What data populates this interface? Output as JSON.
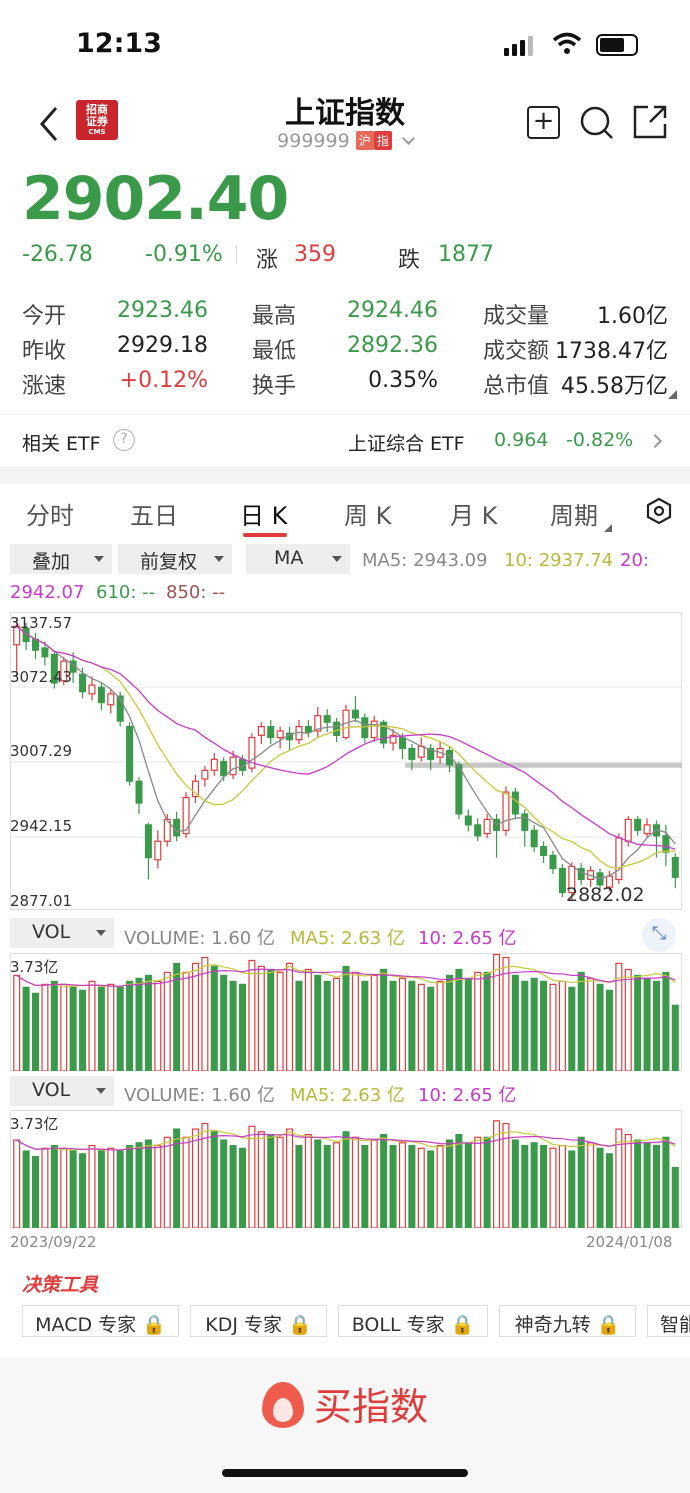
{
  "status": {
    "time": "12:13"
  },
  "header": {
    "title": "上证指数",
    "code": "999999",
    "tag_market": "沪",
    "tag_index": "指",
    "logo_text": "招商证券",
    "logo_sub": "CMS"
  },
  "quote": {
    "price": "2902.40",
    "change": "-26.78",
    "change_pct": "-0.91%",
    "up_label": "涨",
    "up_count": "359",
    "down_label": "跌",
    "down_count": "1877"
  },
  "stats": [
    {
      "label": "今开",
      "value": "2923.46",
      "color": "green"
    },
    {
      "label": "最高",
      "value": "2924.46",
      "color": "green"
    },
    {
      "label": "成交量",
      "value": "1.60亿",
      "color": "dark"
    },
    {
      "label": "昨收",
      "value": "2929.18",
      "color": "dark"
    },
    {
      "label": "最低",
      "value": "2892.36",
      "color": "green"
    },
    {
      "label": "成交额",
      "value": "1738.47亿",
      "color": "dark"
    },
    {
      "label": "涨速",
      "value": "+0.12%",
      "color": "red"
    },
    {
      "label": "换手",
      "value": "0.35%",
      "color": "dark"
    },
    {
      "label": "总市值",
      "value": "45.58万亿",
      "color": "dark"
    }
  ],
  "etf": {
    "label": "相关 ETF",
    "help": "?",
    "name": "上证综合 ETF",
    "price": "0.964",
    "change": "-0.82%"
  },
  "tabs": [
    "分时",
    "五日",
    "日 K",
    "周 K",
    "月 K",
    "周期"
  ],
  "active_tab": "日 K",
  "selectors": {
    "overlay": "叠加",
    "adjust": "前复权",
    "indicator": "MA"
  },
  "ma_line": {
    "ma5": "MA5: 2943.09",
    "ma10": "10: 2937.74",
    "ma20_a": "20:",
    "ma20_b": "2942.07",
    "ma610": "610: --",
    "ma850": "850: --"
  },
  "kchart": {
    "y_labels": [
      "3137.57",
      "3072.43",
      "3007.29",
      "2942.15",
      "2877.01"
    ],
    "low_mark": "2882.02",
    "colors": {
      "up": "#e03c3c",
      "down": "#3a9a4a",
      "ma5": "#888888",
      "ma10": "#c8c83a",
      "ma20": "#c83ac8"
    }
  },
  "vol1": {
    "selector": "VOL",
    "volume": "VOLUME: 1.60 亿",
    "ma5": "MA5: 2.63 亿",
    "ma10": "10: 2.65 亿",
    "max": "3.73亿"
  },
  "vol2": {
    "selector": "VOL",
    "volume": "VOLUME: 1.60 亿",
    "ma5": "MA5: 2.63 亿",
    "ma10": "10: 2.65 亿",
    "max": "3.73亿"
  },
  "dates": {
    "start": "2023/09/22",
    "end": "2024/01/08"
  },
  "tools": {
    "title": "决策工具",
    "items": [
      "MACD 专家",
      "KDJ 专家",
      "BOLL 专家",
      "神奇九转",
      "智能"
    ]
  },
  "buy_label": "买指数",
  "candles": [
    {
      "o": 3115,
      "c": 3132,
      "h": 3140,
      "l": 3085
    },
    {
      "o": 3130,
      "c": 3118,
      "h": 3135,
      "l": 3110
    },
    {
      "o": 3120,
      "c": 3110,
      "h": 3126,
      "l": 3102
    },
    {
      "o": 3112,
      "c": 3104,
      "h": 3118,
      "l": 3096
    },
    {
      "o": 3106,
      "c": 3080,
      "h": 3110,
      "l": 3075
    },
    {
      "o": 3082,
      "c": 3100,
      "h": 3104,
      "l": 3078
    },
    {
      "o": 3100,
      "c": 3090,
      "h": 3108,
      "l": 3080
    },
    {
      "o": 3088,
      "c": 3072,
      "h": 3094,
      "l": 3066
    },
    {
      "o": 3070,
      "c": 3078,
      "h": 3086,
      "l": 3064
    },
    {
      "o": 3076,
      "c": 3062,
      "h": 3080,
      "l": 3055
    },
    {
      "o": 3060,
      "c": 3070,
      "h": 3074,
      "l": 3052
    },
    {
      "o": 3068,
      "c": 3045,
      "h": 3072,
      "l": 3040
    },
    {
      "o": 3040,
      "c": 2990,
      "h": 3044,
      "l": 2986
    },
    {
      "o": 2990,
      "c": 2970,
      "h": 2994,
      "l": 2960
    },
    {
      "o": 2950,
      "c": 2920,
      "h": 2952,
      "l": 2900
    },
    {
      "o": 2918,
      "c": 2935,
      "h": 2945,
      "l": 2910
    },
    {
      "o": 2935,
      "c": 2955,
      "h": 2960,
      "l": 2930
    },
    {
      "o": 2955,
      "c": 2940,
      "h": 2962,
      "l": 2935
    },
    {
      "o": 2942,
      "c": 2975,
      "h": 2980,
      "l": 2938
    },
    {
      "o": 2976,
      "c": 2990,
      "h": 2996,
      "l": 2970
    },
    {
      "o": 2992,
      "c": 3000,
      "h": 3004,
      "l": 2985
    },
    {
      "o": 3000,
      "c": 3010,
      "h": 3016,
      "l": 2995
    },
    {
      "o": 3008,
      "c": 2995,
      "h": 3012,
      "l": 2990
    },
    {
      "o": 2996,
      "c": 3012,
      "h": 3018,
      "l": 2992
    },
    {
      "o": 3010,
      "c": 3000,
      "h": 3014,
      "l": 2995
    },
    {
      "o": 3002,
      "c": 3030,
      "h": 3034,
      "l": 2998
    },
    {
      "o": 3032,
      "c": 3040,
      "h": 3044,
      "l": 3024
    },
    {
      "o": 3040,
      "c": 3030,
      "h": 3046,
      "l": 3024
    },
    {
      "o": 3030,
      "c": 3036,
      "h": 3040,
      "l": 3020
    },
    {
      "o": 3034,
      "c": 3028,
      "h": 3040,
      "l": 3018
    },
    {
      "o": 3028,
      "c": 3040,
      "h": 3046,
      "l": 3024
    },
    {
      "o": 3040,
      "c": 3035,
      "h": 3046,
      "l": 3030
    },
    {
      "o": 3036,
      "c": 3050,
      "h": 3058,
      "l": 3030
    },
    {
      "o": 3050,
      "c": 3044,
      "h": 3056,
      "l": 3035
    },
    {
      "o": 3044,
      "c": 3032,
      "h": 3048,
      "l": 3026
    },
    {
      "o": 3030,
      "c": 3055,
      "h": 3060,
      "l": 3028
    },
    {
      "o": 3055,
      "c": 3048,
      "h": 3068,
      "l": 3044
    },
    {
      "o": 3048,
      "c": 3030,
      "h": 3052,
      "l": 3025
    },
    {
      "o": 3030,
      "c": 3045,
      "h": 3050,
      "l": 3026
    },
    {
      "o": 3044,
      "c": 3025,
      "h": 3046,
      "l": 3020
    },
    {
      "o": 3025,
      "c": 3032,
      "h": 3038,
      "l": 3018
    },
    {
      "o": 3030,
      "c": 3020,
      "h": 3034,
      "l": 3010
    },
    {
      "o": 3020,
      "c": 3010,
      "h": 3024,
      "l": 3000
    },
    {
      "o": 3012,
      "c": 3022,
      "h": 3030,
      "l": 3008
    },
    {
      "o": 3020,
      "c": 3010,
      "h": 3024,
      "l": 3000
    },
    {
      "o": 3012,
      "c": 3020,
      "h": 3026,
      "l": 3006
    },
    {
      "o": 3018,
      "c": 3005,
      "h": 3022,
      "l": 2998
    },
    {
      "o": 3005,
      "c": 2960,
      "h": 3008,
      "l": 2955
    },
    {
      "o": 2958,
      "c": 2950,
      "h": 2964,
      "l": 2944
    },
    {
      "o": 2950,
      "c": 2940,
      "h": 2956,
      "l": 2935
    },
    {
      "o": 2942,
      "c": 2955,
      "h": 2960,
      "l": 2938
    },
    {
      "o": 2955,
      "c": 2945,
      "h": 2960,
      "l": 2920
    },
    {
      "o": 2945,
      "c": 2980,
      "h": 2985,
      "l": 2940
    },
    {
      "o": 2980,
      "c": 2960,
      "h": 2984,
      "l": 2955
    },
    {
      "o": 2960,
      "c": 2945,
      "h": 2964,
      "l": 2930
    },
    {
      "o": 2945,
      "c": 2930,
      "h": 2950,
      "l": 2925
    },
    {
      "o": 2930,
      "c": 2922,
      "h": 2935,
      "l": 2915
    },
    {
      "o": 2922,
      "c": 2910,
      "h": 2926,
      "l": 2905
    },
    {
      "o": 2910,
      "c": 2888,
      "h": 2914,
      "l": 2884
    },
    {
      "o": 2888,
      "c": 2912,
      "h": 2916,
      "l": 2880
    },
    {
      "o": 2910,
      "c": 2900,
      "h": 2915,
      "l": 2895
    },
    {
      "o": 2900,
      "c": 2908,
      "h": 2912,
      "l": 2893
    },
    {
      "o": 2906,
      "c": 2895,
      "h": 2910,
      "l": 2890
    },
    {
      "o": 2893,
      "c": 2903,
      "h": 2908,
      "l": 2889
    },
    {
      "o": 2900,
      "c": 2938,
      "h": 2942,
      "l": 2896
    },
    {
      "o": 2935,
      "c": 2955,
      "h": 2958,
      "l": 2930
    },
    {
      "o": 2955,
      "c": 2945,
      "h": 2958,
      "l": 2940
    },
    {
      "o": 2942,
      "c": 2950,
      "h": 2956,
      "l": 2938
    },
    {
      "o": 2950,
      "c": 2940,
      "h": 2954,
      "l": 2920
    },
    {
      "o": 2940,
      "c": 2925,
      "h": 2950,
      "l": 2912
    },
    {
      "o": 2920,
      "c": 2902,
      "h": 2924,
      "l": 2892
    }
  ],
  "volumes": [
    {
      "v": 3.2,
      "up": true
    },
    {
      "v": 2.8,
      "up": false
    },
    {
      "v": 2.6,
      "up": false
    },
    {
      "v": 2.9,
      "up": true
    },
    {
      "v": 3.0,
      "up": false
    },
    {
      "v": 2.9,
      "up": true
    },
    {
      "v": 2.8,
      "up": false
    },
    {
      "v": 2.7,
      "up": false
    },
    {
      "v": 3.0,
      "up": true
    },
    {
      "v": 2.8,
      "up": false
    },
    {
      "v": 2.9,
      "up": true
    },
    {
      "v": 2.8,
      "up": false
    },
    {
      "v": 3.0,
      "up": false
    },
    {
      "v": 3.1,
      "up": false
    },
    {
      "v": 3.2,
      "up": false
    },
    {
      "v": 3.0,
      "up": true
    },
    {
      "v": 3.3,
      "up": true
    },
    {
      "v": 3.6,
      "up": false
    },
    {
      "v": 3.3,
      "up": true
    },
    {
      "v": 3.6,
      "up": true
    },
    {
      "v": 3.8,
      "up": true
    },
    {
      "v": 3.5,
      "up": false
    },
    {
      "v": 3.2,
      "up": false
    },
    {
      "v": 3.0,
      "up": false
    },
    {
      "v": 2.9,
      "up": false
    },
    {
      "v": 3.7,
      "up": true
    },
    {
      "v": 3.5,
      "up": true
    },
    {
      "v": 3.4,
      "up": false
    },
    {
      "v": 3.3,
      "up": true
    },
    {
      "v": 3.6,
      "up": true
    },
    {
      "v": 3.0,
      "up": false
    },
    {
      "v": 3.4,
      "up": true
    },
    {
      "v": 3.2,
      "up": false
    },
    {
      "v": 3.0,
      "up": false
    },
    {
      "v": 3.1,
      "up": true
    },
    {
      "v": 3.5,
      "up": false
    },
    {
      "v": 3.3,
      "up": true
    },
    {
      "v": 3.0,
      "up": false
    },
    {
      "v": 3.2,
      "up": true
    },
    {
      "v": 3.4,
      "up": false
    },
    {
      "v": 3.0,
      "up": false
    },
    {
      "v": 3.1,
      "up": true
    },
    {
      "v": 3.0,
      "up": false
    },
    {
      "v": 2.9,
      "up": true
    },
    {
      "v": 2.8,
      "up": false
    },
    {
      "v": 3.0,
      "up": true
    },
    {
      "v": 3.2,
      "up": false
    },
    {
      "v": 3.4,
      "up": false
    },
    {
      "v": 3.1,
      "up": false
    },
    {
      "v": 3.3,
      "up": true
    },
    {
      "v": 3.3,
      "up": false
    },
    {
      "v": 3.9,
      "up": true
    },
    {
      "v": 3.8,
      "up": true
    },
    {
      "v": 3.2,
      "up": false
    },
    {
      "v": 3.0,
      "up": false
    },
    {
      "v": 3.1,
      "up": false
    },
    {
      "v": 3.0,
      "up": false
    },
    {
      "v": 2.9,
      "up": true
    },
    {
      "v": 3.0,
      "up": true
    },
    {
      "v": 2.8,
      "up": false
    },
    {
      "v": 3.3,
      "up": false
    },
    {
      "v": 3.1,
      "up": true
    },
    {
      "v": 2.9,
      "up": false
    },
    {
      "v": 2.7,
      "up": false
    },
    {
      "v": 3.6,
      "up": true
    },
    {
      "v": 3.4,
      "up": true
    },
    {
      "v": 3.2,
      "up": false
    },
    {
      "v": 3.1,
      "up": false
    },
    {
      "v": 3.0,
      "up": false
    },
    {
      "v": 3.3,
      "up": false
    },
    {
      "v": 2.2,
      "up": false
    }
  ]
}
